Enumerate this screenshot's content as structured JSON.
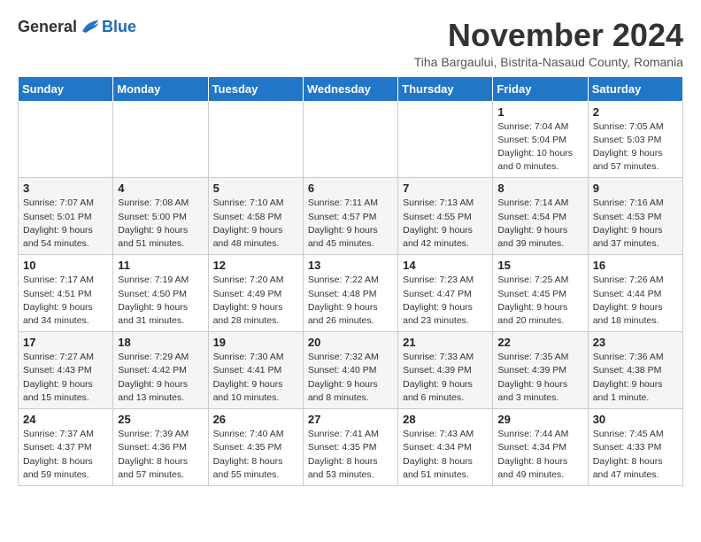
{
  "logo": {
    "general": "General",
    "blue": "Blue"
  },
  "title": "November 2024",
  "subtitle": "Tiha Bargaului, Bistrita-Nasaud County, Romania",
  "days_header": [
    "Sunday",
    "Monday",
    "Tuesday",
    "Wednesday",
    "Thursday",
    "Friday",
    "Saturday"
  ],
  "weeks": [
    [
      {
        "day": "",
        "info": ""
      },
      {
        "day": "",
        "info": ""
      },
      {
        "day": "",
        "info": ""
      },
      {
        "day": "",
        "info": ""
      },
      {
        "day": "",
        "info": ""
      },
      {
        "day": "1",
        "info": "Sunrise: 7:04 AM\nSunset: 5:04 PM\nDaylight: 10 hours\nand 0 minutes."
      },
      {
        "day": "2",
        "info": "Sunrise: 7:05 AM\nSunset: 5:03 PM\nDaylight: 9 hours\nand 57 minutes."
      }
    ],
    [
      {
        "day": "3",
        "info": "Sunrise: 7:07 AM\nSunset: 5:01 PM\nDaylight: 9 hours\nand 54 minutes."
      },
      {
        "day": "4",
        "info": "Sunrise: 7:08 AM\nSunset: 5:00 PM\nDaylight: 9 hours\nand 51 minutes."
      },
      {
        "day": "5",
        "info": "Sunrise: 7:10 AM\nSunset: 4:58 PM\nDaylight: 9 hours\nand 48 minutes."
      },
      {
        "day": "6",
        "info": "Sunrise: 7:11 AM\nSunset: 4:57 PM\nDaylight: 9 hours\nand 45 minutes."
      },
      {
        "day": "7",
        "info": "Sunrise: 7:13 AM\nSunset: 4:55 PM\nDaylight: 9 hours\nand 42 minutes."
      },
      {
        "day": "8",
        "info": "Sunrise: 7:14 AM\nSunset: 4:54 PM\nDaylight: 9 hours\nand 39 minutes."
      },
      {
        "day": "9",
        "info": "Sunrise: 7:16 AM\nSunset: 4:53 PM\nDaylight: 9 hours\nand 37 minutes."
      }
    ],
    [
      {
        "day": "10",
        "info": "Sunrise: 7:17 AM\nSunset: 4:51 PM\nDaylight: 9 hours\nand 34 minutes."
      },
      {
        "day": "11",
        "info": "Sunrise: 7:19 AM\nSunset: 4:50 PM\nDaylight: 9 hours\nand 31 minutes."
      },
      {
        "day": "12",
        "info": "Sunrise: 7:20 AM\nSunset: 4:49 PM\nDaylight: 9 hours\nand 28 minutes."
      },
      {
        "day": "13",
        "info": "Sunrise: 7:22 AM\nSunset: 4:48 PM\nDaylight: 9 hours\nand 26 minutes."
      },
      {
        "day": "14",
        "info": "Sunrise: 7:23 AM\nSunset: 4:47 PM\nDaylight: 9 hours\nand 23 minutes."
      },
      {
        "day": "15",
        "info": "Sunrise: 7:25 AM\nSunset: 4:45 PM\nDaylight: 9 hours\nand 20 minutes."
      },
      {
        "day": "16",
        "info": "Sunrise: 7:26 AM\nSunset: 4:44 PM\nDaylight: 9 hours\nand 18 minutes."
      }
    ],
    [
      {
        "day": "17",
        "info": "Sunrise: 7:27 AM\nSunset: 4:43 PM\nDaylight: 9 hours\nand 15 minutes."
      },
      {
        "day": "18",
        "info": "Sunrise: 7:29 AM\nSunset: 4:42 PM\nDaylight: 9 hours\nand 13 minutes."
      },
      {
        "day": "19",
        "info": "Sunrise: 7:30 AM\nSunset: 4:41 PM\nDaylight: 9 hours\nand 10 minutes."
      },
      {
        "day": "20",
        "info": "Sunrise: 7:32 AM\nSunset: 4:40 PM\nDaylight: 9 hours\nand 8 minutes."
      },
      {
        "day": "21",
        "info": "Sunrise: 7:33 AM\nSunset: 4:39 PM\nDaylight: 9 hours\nand 6 minutes."
      },
      {
        "day": "22",
        "info": "Sunrise: 7:35 AM\nSunset: 4:39 PM\nDaylight: 9 hours\nand 3 minutes."
      },
      {
        "day": "23",
        "info": "Sunrise: 7:36 AM\nSunset: 4:38 PM\nDaylight: 9 hours\nand 1 minute."
      }
    ],
    [
      {
        "day": "24",
        "info": "Sunrise: 7:37 AM\nSunset: 4:37 PM\nDaylight: 8 hours\nand 59 minutes."
      },
      {
        "day": "25",
        "info": "Sunrise: 7:39 AM\nSunset: 4:36 PM\nDaylight: 8 hours\nand 57 minutes."
      },
      {
        "day": "26",
        "info": "Sunrise: 7:40 AM\nSunset: 4:35 PM\nDaylight: 8 hours\nand 55 minutes."
      },
      {
        "day": "27",
        "info": "Sunrise: 7:41 AM\nSunset: 4:35 PM\nDaylight: 8 hours\nand 53 minutes."
      },
      {
        "day": "28",
        "info": "Sunrise: 7:43 AM\nSunset: 4:34 PM\nDaylight: 8 hours\nand 51 minutes."
      },
      {
        "day": "29",
        "info": "Sunrise: 7:44 AM\nSunset: 4:34 PM\nDaylight: 8 hours\nand 49 minutes."
      },
      {
        "day": "30",
        "info": "Sunrise: 7:45 AM\nSunset: 4:33 PM\nDaylight: 8 hours\nand 47 minutes."
      }
    ]
  ]
}
